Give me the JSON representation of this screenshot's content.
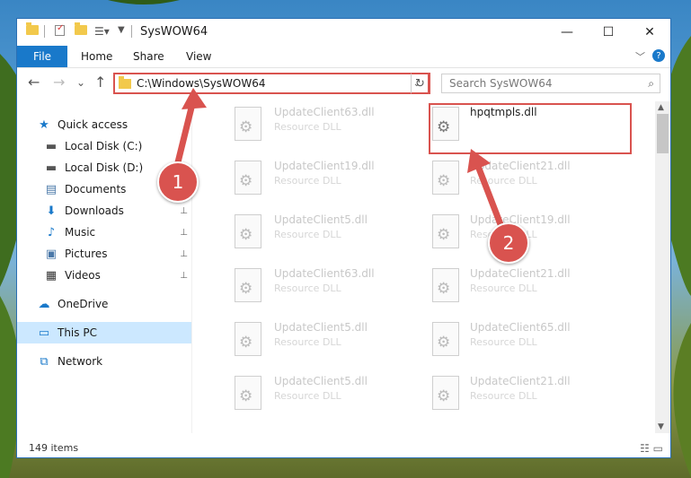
{
  "window": {
    "title": "SysWOW64",
    "controls": {
      "minimize": "—",
      "maximize": "☐",
      "close": "✕"
    }
  },
  "ribbon": {
    "file": "File",
    "tabs": [
      "Home",
      "Share",
      "View"
    ],
    "expand": "﹀",
    "help": "?"
  },
  "nav": {
    "back": "←",
    "forward": "→",
    "recent": "⌄",
    "up": "↑",
    "address": "C:\\Windows\\SysWOW64",
    "address_dropdown": "⌄",
    "refresh": "↻",
    "search_placeholder": "Search SysWOW64"
  },
  "sidebar": {
    "items": [
      {
        "label": "Quick access",
        "icon": "star-icon",
        "glyph": "★",
        "color": "#1979ca",
        "pinned": false
      },
      {
        "label": "Local Disk (C:)",
        "icon": "drive-icon",
        "glyph": "▬",
        "color": "#555555",
        "pinned": false
      },
      {
        "label": "Local Disk (D:)",
        "icon": "drive-icon",
        "glyph": "▬",
        "color": "#555555",
        "pinned": false
      },
      {
        "label": "Documents",
        "icon": "documents-icon",
        "glyph": "▤",
        "color": "#4a78a8",
        "pinned": false
      },
      {
        "label": "Downloads",
        "icon": "download-icon",
        "glyph": "⬇",
        "color": "#1979ca",
        "pinned": true
      },
      {
        "label": "Music",
        "icon": "music-icon",
        "glyph": "♪",
        "color": "#1979ca",
        "pinned": true
      },
      {
        "label": "Pictures",
        "icon": "pictures-icon",
        "glyph": "▣",
        "color": "#4a78a8",
        "pinned": true
      },
      {
        "label": "Videos",
        "icon": "video-icon",
        "glyph": "▦",
        "color": "#333333",
        "pinned": true
      },
      {
        "label": "OneDrive",
        "icon": "cloud-icon",
        "glyph": "☁",
        "color": "#1979ca",
        "pinned": false
      },
      {
        "label": "This PC",
        "icon": "computer-icon",
        "glyph": "▭",
        "color": "#1979ca",
        "pinned": false,
        "selected": true
      },
      {
        "label": "Network",
        "icon": "network-icon",
        "glyph": "⧉",
        "color": "#1979ca",
        "pinned": false
      }
    ],
    "pin_glyph": "📌"
  },
  "files": [
    {
      "name": "UpdateClient63.dll",
      "type": "Resource DLL"
    },
    {
      "name": "hpqtmpls.dll",
      "type": "",
      "highlighted": true
    },
    {
      "name": "UpdateClient19.dll",
      "type": "Resource DLL"
    },
    {
      "name": "UpdateClient21.dll",
      "type": "Resource DLL"
    },
    {
      "name": "UpdateClient5.dll",
      "type": "Resource DLL"
    },
    {
      "name": "UpdateClient19.dll",
      "type": "Resource DLL"
    },
    {
      "name": "UpdateClient63.dll",
      "type": "Resource DLL"
    },
    {
      "name": "UpdateClient21.dll",
      "type": "Resource DLL"
    },
    {
      "name": "UpdateClient5.dll",
      "type": "Resource DLL"
    },
    {
      "name": "UpdateClient65.dll",
      "type": "Resource DLL"
    },
    {
      "name": "UpdateClient5.dll",
      "type": "Resource DLL"
    },
    {
      "name": "UpdateClient21.dll",
      "type": "Resource DLL"
    }
  ],
  "status": {
    "count": "149 items"
  },
  "markers": [
    "1",
    "2"
  ],
  "colors": {
    "accent": "#1979ca",
    "annotation": "#d9534f"
  }
}
